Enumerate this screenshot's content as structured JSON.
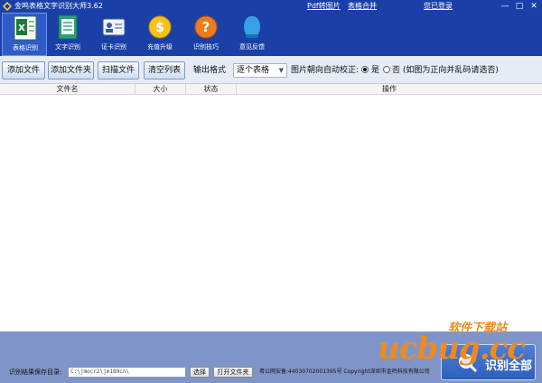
{
  "window": {
    "title": "金鸣表格文字识别大师3.62",
    "links": [
      "Pdf转图片",
      "表格合并",
      "您已登录"
    ]
  },
  "toolbar": {
    "items": [
      {
        "label": "表格识别",
        "icon": "excel-icon"
      },
      {
        "label": "文字识别",
        "icon": "document-icon"
      },
      {
        "label": "证卡识别",
        "icon": "id-card-icon"
      },
      {
        "label": "充值升级",
        "icon": "coin-icon"
      },
      {
        "label": "识别技巧",
        "icon": "help-icon"
      },
      {
        "label": "意见反馈",
        "icon": "feedback-icon"
      }
    ]
  },
  "actions": {
    "add_file": "添加文件",
    "add_folder": "添加文件夹",
    "scan_file": "扫描文件",
    "clear_list": "清空列表",
    "output_format_label": "输出格式",
    "output_format_value": "逐个表格",
    "auto_correct_label": "图片朝向自动校正:",
    "option_yes": "是",
    "option_no": "否 (如图为正向并乱码请选否)"
  },
  "table": {
    "columns": [
      "文件名",
      "大小",
      "状态",
      "操作"
    ]
  },
  "footer": {
    "save_dir_label": "识别结果保存目录:",
    "save_dir_value": "C:\\jmocr2\\jm189cn\\",
    "select_button": "选择",
    "open_folder_button": "打开文件夹",
    "icp": "粤公网安备:44030702001395号 Copyright深圳市金鸣科技有限公司",
    "start_button": "识别全部"
  },
  "watermark": {
    "cn": "软件下载站",
    "en": "ucbug.cc"
  },
  "colors": {
    "title_bar": "#1a40a8",
    "footer": "#7f95c9",
    "watermark": "#f08a1d"
  }
}
